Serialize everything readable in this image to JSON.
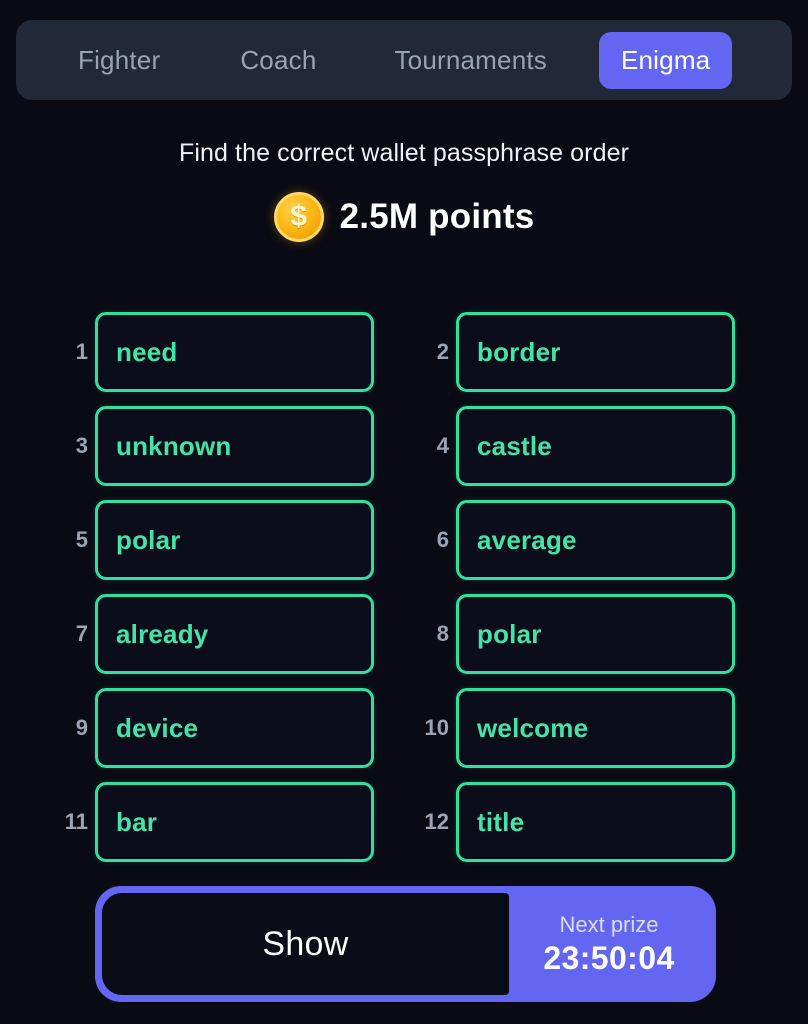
{
  "theme": {
    "background": "#090a14",
    "navbar_background": "#212838",
    "accent_purple": "#6366f1",
    "accent_green": "#2fe0a0",
    "word_text_green": "#46e3a8",
    "index_gray": "#9aa4b6",
    "coin_gold": "#fcb813"
  },
  "nav": {
    "tabs": [
      {
        "label": "Fighter",
        "active": false
      },
      {
        "label": "Coach",
        "active": false
      },
      {
        "label": "Tournaments",
        "active": false
      },
      {
        "label": "Enigma",
        "active": true
      }
    ]
  },
  "header": {
    "subtitle": "Find the correct wallet passphrase order",
    "coin_icon": "coin-dollar-icon",
    "coin_symbol": "$",
    "points": "2.5M points"
  },
  "grid": {
    "rows": [
      {
        "left": {
          "index": "1",
          "word": "need"
        },
        "right": {
          "index": "2",
          "word": "border"
        }
      },
      {
        "left": {
          "index": "3",
          "word": "unknown"
        },
        "right": {
          "index": "4",
          "word": "castle"
        }
      },
      {
        "left": {
          "index": "5",
          "word": "polar"
        },
        "right": {
          "index": "6",
          "word": "average"
        }
      },
      {
        "left": {
          "index": "7",
          "word": "already"
        },
        "right": {
          "index": "8",
          "word": "polar"
        }
      },
      {
        "left": {
          "index": "9",
          "word": "device"
        },
        "right": {
          "index": "10",
          "word": "welcome"
        }
      },
      {
        "left": {
          "index": "11",
          "word": "bar"
        },
        "right": {
          "index": "12",
          "word": "title"
        }
      }
    ]
  },
  "action_bar": {
    "show_label": "Show",
    "prize_label": "Next prize",
    "prize_timer": "23:50:04"
  }
}
